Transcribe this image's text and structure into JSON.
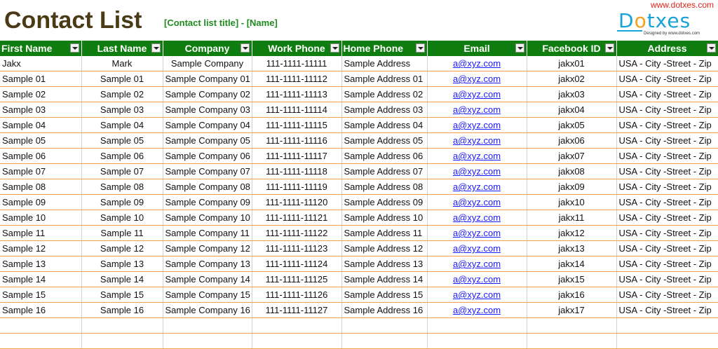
{
  "header": {
    "title": "Contact List",
    "subtitle": "[Contact list title] - [Name]",
    "brand_url": "www.dotxes.com",
    "logo_text_a": "D",
    "logo_text_o": "o",
    "logo_text_b": "txes",
    "logo_tagline": "Designed by www.dotxes.com"
  },
  "columns": [
    "First Name",
    "Last Name",
    "Company",
    "Work Phone",
    "Home Phone",
    "Email",
    "Facebook ID",
    "Address"
  ],
  "rows": [
    [
      "Jakx",
      "Mark",
      "Sample Company",
      "111-1111-11111",
      "Sample Address",
      "a@xyz.com",
      "jakx01",
      "USA - City -Street - Zip"
    ],
    [
      "Sample 01",
      "Sample 01",
      "Sample Company 01",
      "111-1111-11112",
      "Sample Address 01",
      "a@xyz.com",
      "jakx02",
      "USA - City -Street - Zip"
    ],
    [
      "Sample 02",
      "Sample 02",
      "Sample Company 02",
      "111-1111-11113",
      "Sample Address 02",
      "a@xyz.com",
      "jakx03",
      "USA - City -Street - Zip"
    ],
    [
      "Sample 03",
      "Sample 03",
      "Sample Company 03",
      "111-1111-11114",
      "Sample Address 03",
      "a@xyz.com",
      "jakx04",
      "USA - City -Street - Zip"
    ],
    [
      "Sample 04",
      "Sample 04",
      "Sample Company 04",
      "111-1111-11115",
      "Sample Address 04",
      "a@xyz.com",
      "jakx05",
      "USA - City -Street - Zip"
    ],
    [
      "Sample 05",
      "Sample 05",
      "Sample Company 05",
      "111-1111-11116",
      "Sample Address 05",
      "a@xyz.com",
      "jakx06",
      "USA - City -Street - Zip"
    ],
    [
      "Sample 06",
      "Sample 06",
      "Sample Company 06",
      "111-1111-11117",
      "Sample Address 06",
      "a@xyz.com",
      "jakx07",
      "USA - City -Street - Zip"
    ],
    [
      "Sample 07",
      "Sample 07",
      "Sample Company 07",
      "111-1111-11118",
      "Sample Address 07",
      "a@xyz.com",
      "jakx08",
      "USA - City -Street - Zip"
    ],
    [
      "Sample 08",
      "Sample 08",
      "Sample Company 08",
      "111-1111-11119",
      "Sample Address 08",
      "a@xyz.com",
      "jakx09",
      "USA - City -Street - Zip"
    ],
    [
      "Sample 09",
      "Sample 09",
      "Sample Company 09",
      "111-1111-11120",
      "Sample Address 09",
      "a@xyz.com",
      "jakx10",
      "USA - City -Street - Zip"
    ],
    [
      "Sample 10",
      "Sample 10",
      "Sample Company 10",
      "111-1111-11121",
      "Sample Address 10",
      "a@xyz.com",
      "jakx11",
      "USA - City -Street - Zip"
    ],
    [
      "Sample 11",
      "Sample 11",
      "Sample Company 11",
      "111-1111-11122",
      "Sample Address 11",
      "a@xyz.com",
      "jakx12",
      "USA - City -Street - Zip"
    ],
    [
      "Sample 12",
      "Sample 12",
      "Sample Company 12",
      "111-1111-11123",
      "Sample Address 12",
      "a@xyz.com",
      "jakx13",
      "USA - City -Street - Zip"
    ],
    [
      "Sample 13",
      "Sample 13",
      "Sample Company 13",
      "111-1111-11124",
      "Sample Address 13",
      "a@xyz.com",
      "jakx14",
      "USA - City -Street - Zip"
    ],
    [
      "Sample 14",
      "Sample 14",
      "Sample Company 14",
      "111-1111-11125",
      "Sample Address 14",
      "a@xyz.com",
      "jakx15",
      "USA - City -Street - Zip"
    ],
    [
      "Sample 15",
      "Sample 15",
      "Sample Company 15",
      "111-1111-11126",
      "Sample Address 15",
      "a@xyz.com",
      "jakx16",
      "USA - City -Street - Zip"
    ],
    [
      "Sample 16",
      "Sample 16",
      "Sample Company 16",
      "111-1111-11127",
      "Sample Address 16",
      "a@xyz.com",
      "jakx17",
      "USA - City -Street - Zip"
    ]
  ],
  "colors": {
    "header_bg": "#107d10",
    "title": "#4a3b16",
    "subtitle": "#1f8a1f",
    "brand_url": "#e0241b",
    "row_border": "#f0a050",
    "link": "#1a1aff"
  },
  "icons": {
    "column_filter": "dropdown-arrow-icon"
  }
}
